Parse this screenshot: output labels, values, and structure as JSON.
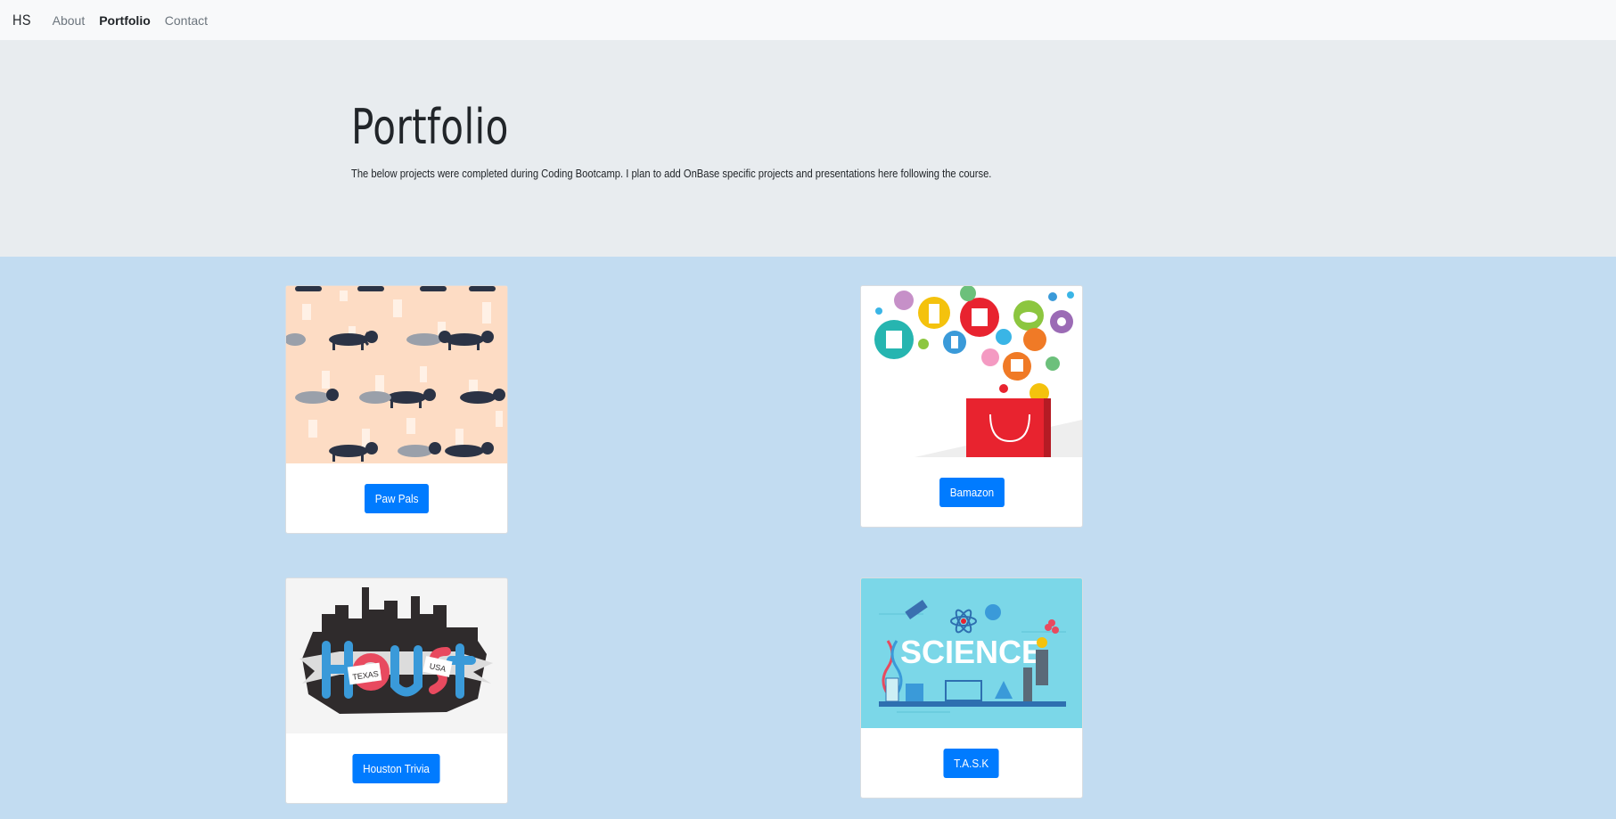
{
  "navbar": {
    "brand": "HS",
    "links": [
      {
        "label": "About"
      },
      {
        "label": "Portfolio"
      },
      {
        "label": "Contact"
      }
    ]
  },
  "jumbotron": {
    "title": "Portfolio",
    "description": "The below projects were completed during Coding Bootcamp. I plan to add OnBase specific projects and presentations here following the course."
  },
  "projects": [
    {
      "button_label": "Paw Pals",
      "image": "dachshund-pattern"
    },
    {
      "button_label": "Bamazon",
      "image": "shopping-bag-icons"
    },
    {
      "button_label": "Houston Trivia",
      "image": "houston-texas-usa-logo"
    },
    {
      "button_label": "T.A.S.K",
      "image": "science-lab"
    }
  ],
  "colors": {
    "button": "#007bff",
    "page_background": "#c2dcf1",
    "jumbotron_background": "#e8ecef"
  }
}
